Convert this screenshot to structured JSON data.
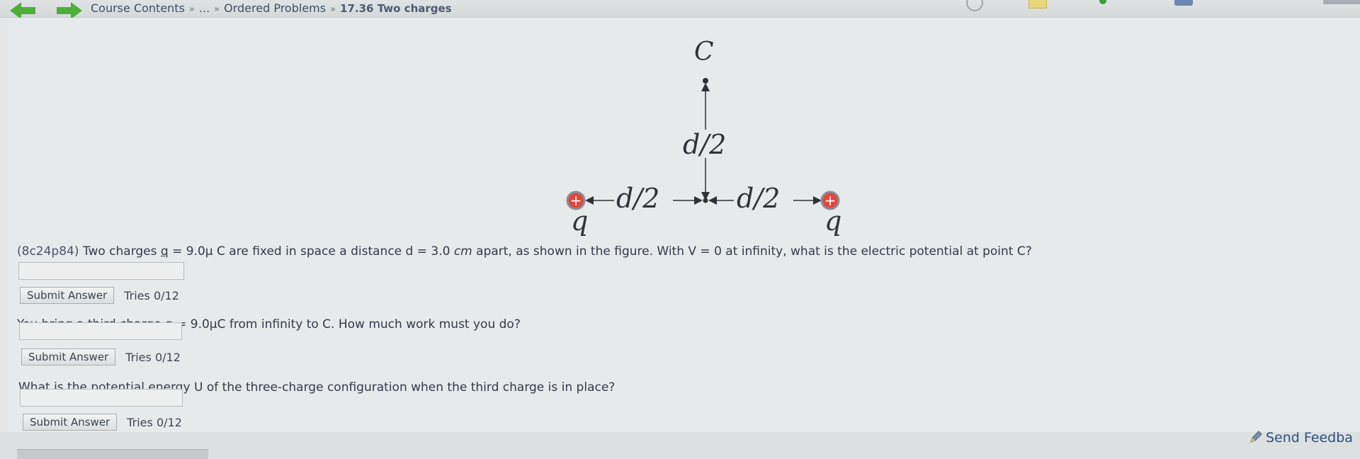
{
  "breadcrumb": {
    "root": "Course Contents",
    "ellipsis": "...",
    "parent": "Ordered Problems",
    "current": "17.36 Two charges",
    "separator": "»"
  },
  "figure": {
    "point_label": "C",
    "vertical_distance": "d/2",
    "left_distance": "d/2",
    "right_distance": "d/2",
    "left_charge_label": "q",
    "right_charge_label": "q",
    "charge_sign": "+"
  },
  "questions": [
    {
      "id": "(8c24p84)",
      "text_a": " Two charges ",
      "text_var": "q",
      "text_b": " = 9.0μ C are fixed in space a distance d = 3.0 ",
      "text_unit": "cm",
      "text_c": " apart, as shown in the figure. With V = 0 at infinity, what is the electric potential at point C?",
      "answer_value": "",
      "submit_label": "Submit Answer",
      "tries": "Tries 0/12"
    },
    {
      "text": "You bring a third charge q = 9.0μC from infinity to C. How much work must you do?",
      "answer_value": "",
      "submit_label": "Submit Answer",
      "tries": "Tries 0/12"
    },
    {
      "text": "What is the potential energy U of the three-charge configuration when the third charge is in place?",
      "answer_value": "",
      "submit_label": "Submit Answer",
      "tries": "Tries 0/12"
    }
  ],
  "feedback_label": "Send Feedba",
  "colors": {
    "charge_fill": "#e0463c",
    "nav_arrow": "#4caf3a",
    "link": "#2f4e7c"
  }
}
